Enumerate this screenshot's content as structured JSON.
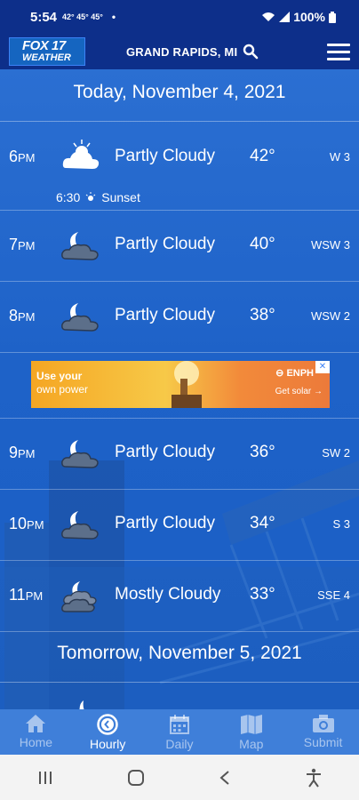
{
  "status_bar": {
    "time": "5:54",
    "temps": "42° 45° 45°",
    "battery": "100%"
  },
  "header": {
    "logo_line1": "FOX 17",
    "logo_line2": "WEATHER",
    "location": "GRAND RAPIDS, MI"
  },
  "today_label": "Today, November 4, 2021",
  "tomorrow_label": "Tomorrow, November 5, 2021",
  "hours": [
    {
      "hour": "6",
      "ampm": "PM",
      "icon": "partly-cloudy-day-icon",
      "condition": "Partly Cloudy",
      "temp": "42°",
      "wind": "W 3"
    },
    {
      "hour": "7",
      "ampm": "PM",
      "icon": "partly-cloudy-night-icon",
      "condition": "Partly Cloudy",
      "temp": "40°",
      "wind": "WSW 3"
    },
    {
      "hour": "8",
      "ampm": "PM",
      "icon": "partly-cloudy-night-icon",
      "condition": "Partly Cloudy",
      "temp": "38°",
      "wind": "WSW 2"
    },
    {
      "hour": "9",
      "ampm": "PM",
      "icon": "partly-cloudy-night-icon",
      "condition": "Partly Cloudy",
      "temp": "36°",
      "wind": "SW 2"
    },
    {
      "hour": "10",
      "ampm": "PM",
      "icon": "partly-cloudy-night-icon",
      "condition": "Partly Cloudy",
      "temp": "34°",
      "wind": "S 3"
    },
    {
      "hour": "11",
      "ampm": "PM",
      "icon": "mostly-cloudy-night-icon",
      "condition": "Mostly Cloudy",
      "temp": "33°",
      "wind": "SSE 4"
    }
  ],
  "sunset": {
    "time": "6:30",
    "label": "Sunset"
  },
  "ad": {
    "line1": "Use your",
    "line2": "own power",
    "brand": "ENPH",
    "cta": "Get solar →"
  },
  "tabs": [
    {
      "label": "Home",
      "icon": "home-icon"
    },
    {
      "label": "Hourly",
      "icon": "clock-icon"
    },
    {
      "label": "Daily",
      "icon": "calendar-icon"
    },
    {
      "label": "Map",
      "icon": "map-icon"
    },
    {
      "label": "Submit",
      "icon": "camera-icon"
    }
  ],
  "active_tab": "Hourly"
}
